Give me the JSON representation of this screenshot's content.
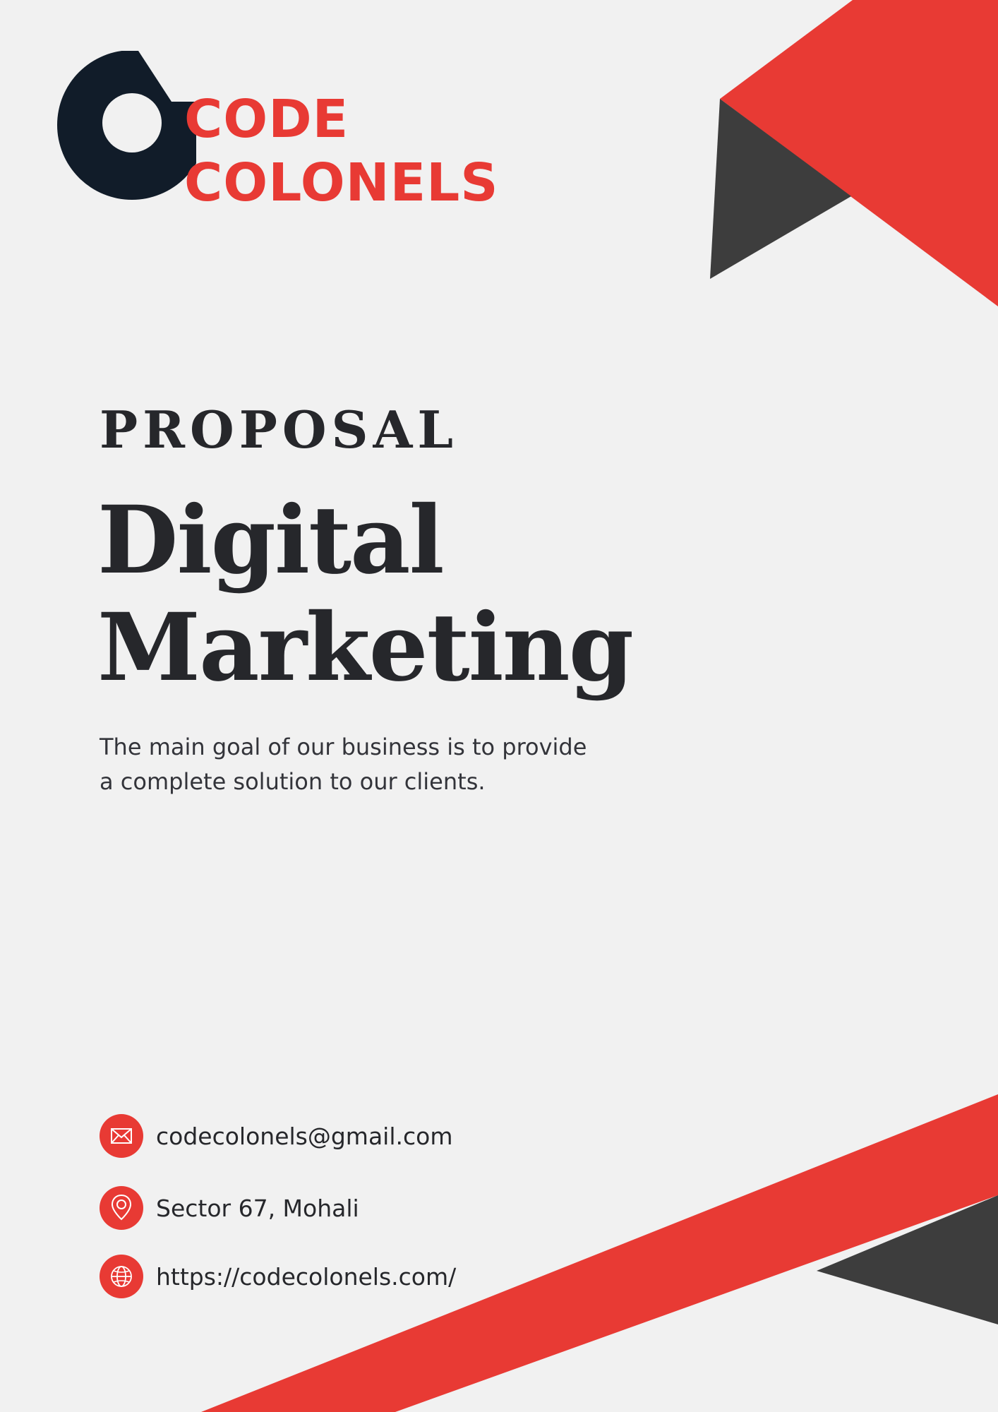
{
  "brand": {
    "line1": "CODE",
    "line2": "COLONELS"
  },
  "colors": {
    "accent": "#e83a34",
    "dark_triangle": "#3d3d3d",
    "logo_navy": "#111c29",
    "text": "#26272b",
    "background": "#f1f1f1"
  },
  "cover": {
    "kicker": "PROPOSAL",
    "title_line1": "Digital",
    "title_line2": "Marketing",
    "tagline_line1": "The main goal of our business is to provide",
    "tagline_line2": "a complete solution to our clients."
  },
  "contacts": [
    {
      "icon": "mail-icon",
      "text": "codecolonels@gmail.com"
    },
    {
      "icon": "location-pin-icon",
      "text": "Sector 67, Mohali"
    },
    {
      "icon": "globe-icon",
      "text": "https://codecolonels.com/"
    }
  ]
}
